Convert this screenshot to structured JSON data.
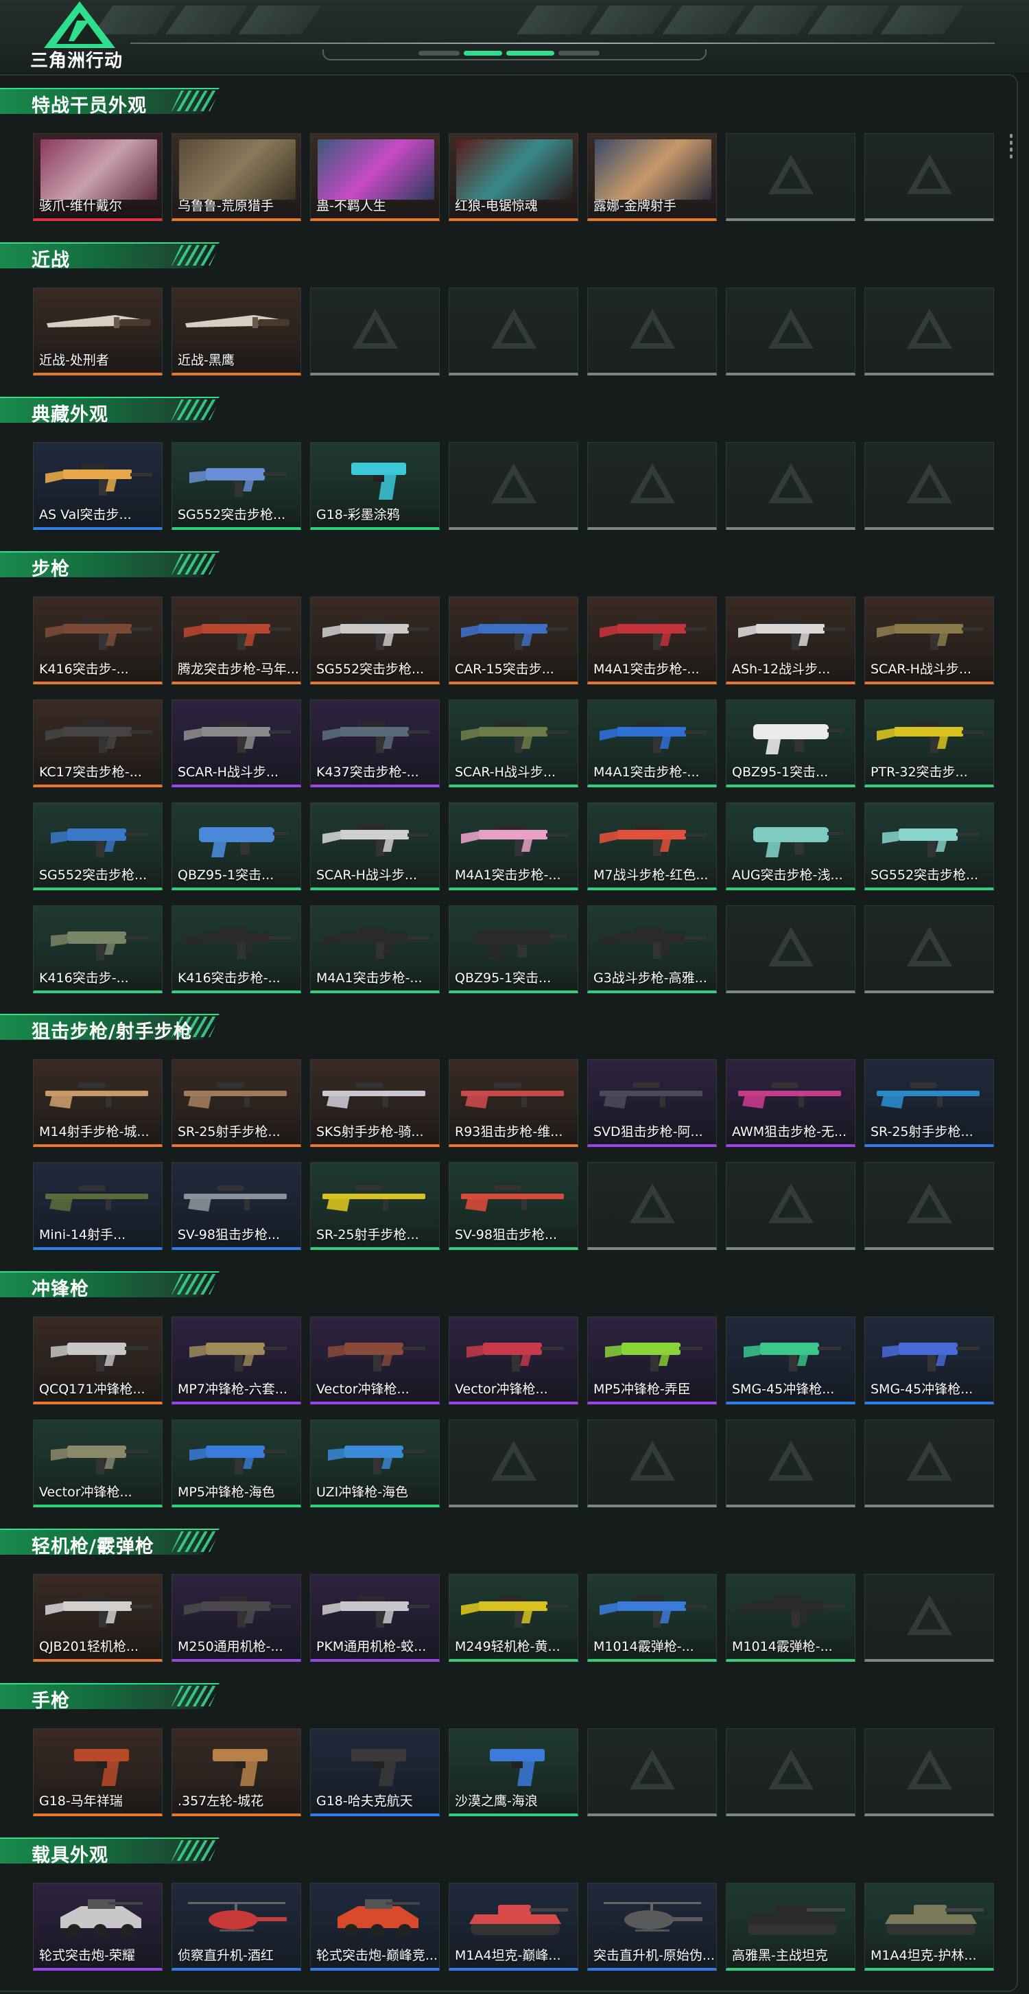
{
  "app": {
    "logo_text": "三角洲行动"
  },
  "sections": [
    {
      "title": "特战干员外观",
      "items": [
        {
          "name": "骇爪-维什戴尔",
          "rarity": "red",
          "kind": "operator"
        },
        {
          "name": "乌鲁鲁-荒原猎手",
          "rarity": "orange",
          "kind": "operator"
        },
        {
          "name": "蛊-不羁人生",
          "rarity": "orange",
          "kind": "operator"
        },
        {
          "name": "红狼-电锯惊魂",
          "rarity": "orange",
          "kind": "operator"
        },
        {
          "name": "露娜-金牌射手",
          "rarity": "orange",
          "kind": "operator"
        }
      ]
    },
    {
      "title": "近战",
      "items": [
        {
          "name": "近战-处刑者",
          "rarity": "orange",
          "kind": "knife"
        },
        {
          "name": "近战-黑鹰",
          "rarity": "orange",
          "kind": "knife"
        }
      ]
    },
    {
      "title": "典藏外观",
      "items": [
        {
          "name": "AS Val突击步...",
          "rarity": "blue",
          "kind": "rifle",
          "color": "#e6a84a"
        },
        {
          "name": "SG552突击步枪...",
          "rarity": "green",
          "kind": "smg",
          "color": "#6a8fd8"
        },
        {
          "name": "G18-彩墨涂鸦",
          "rarity": "green",
          "kind": "pistol",
          "color": "#3cc8d8"
        }
      ]
    },
    {
      "title": "步枪",
      "items": [
        {
          "name": "K416突击步-...",
          "rarity": "orange",
          "kind": "rifle",
          "color": "#7a4a36"
        },
        {
          "name": "腾龙突击步枪-马年...",
          "rarity": "orange",
          "kind": "rifle",
          "color": "#b8452e"
        },
        {
          "name": "SG552突击步枪...",
          "rarity": "orange",
          "kind": "rifle",
          "color": "#c9c9c9"
        },
        {
          "name": "CAR-15突击步...",
          "rarity": "orange",
          "kind": "rifle",
          "color": "#3d6fc4"
        },
        {
          "name": "M4A1突击步枪-...",
          "rarity": "orange",
          "kind": "rifle",
          "color": "#c4323c"
        },
        {
          "name": "ASh-12战斗步...",
          "rarity": "orange",
          "kind": "rifle",
          "color": "#d8d8d8"
        },
        {
          "name": "SCAR-H战斗步...",
          "rarity": "orange",
          "kind": "rifle",
          "color": "#8a7a4a"
        },
        {
          "name": "KC17突击步枪-...",
          "rarity": "orange",
          "kind": "rifle",
          "color": "#444"
        },
        {
          "name": "SCAR-H战斗步...",
          "rarity": "purple",
          "kind": "rifle",
          "color": "#8a8a8a"
        },
        {
          "name": "K437突击步枪-...",
          "rarity": "purple",
          "kind": "rifle",
          "color": "#5a6a7a"
        },
        {
          "name": "SCAR-H战斗步...",
          "rarity": "green",
          "kind": "rifle",
          "color": "#6d7a4a"
        },
        {
          "name": "M4A1突击步枪-...",
          "rarity": "green",
          "kind": "rifle",
          "color": "#2f6fd8"
        },
        {
          "name": "QBZ95-1突击...",
          "rarity": "green",
          "kind": "bullpup",
          "color": "#eaeaea"
        },
        {
          "name": "PTR-32突击步...",
          "rarity": "green",
          "kind": "rifle",
          "color": "#d8c21e"
        },
        {
          "name": "SG552突击步枪...",
          "rarity": "green",
          "kind": "smg",
          "color": "#3a78c8"
        },
        {
          "name": "QBZ95-1突击...",
          "rarity": "green",
          "kind": "bullpup",
          "color": "#4a88d8"
        },
        {
          "name": "SCAR-H战斗步...",
          "rarity": "green",
          "kind": "rifle",
          "color": "#d0d0d0"
        },
        {
          "name": "M4A1突击步枪-...",
          "rarity": "green",
          "kind": "rifle",
          "color": "#e8a0c4"
        },
        {
          "name": "M7战斗步枪-红色...",
          "rarity": "green",
          "kind": "rifle",
          "color": "#e0503a"
        },
        {
          "name": "AUG突击步枪-浅...",
          "rarity": "green",
          "kind": "bullpup",
          "color": "#7ecbc4"
        },
        {
          "name": "SG552突击步枪...",
          "rarity": "green",
          "kind": "smg",
          "color": "#8ad4cf"
        },
        {
          "name": "K416突击步-...",
          "rarity": "green",
          "kind": "smg",
          "color": "#7a8466"
        },
        {
          "name": "K416突击步枪-...",
          "rarity": "green",
          "kind": "rifle",
          "color": "#2a2a2a"
        },
        {
          "name": "M4A1突击步枪-...",
          "rarity": "green",
          "kind": "rifle",
          "color": "#2a2a2a"
        },
        {
          "name": "QBZ95-1突击...",
          "rarity": "green",
          "kind": "bullpup",
          "color": "#2a2a2a"
        },
        {
          "name": "G3战斗步枪-高雅...",
          "rarity": "green",
          "kind": "rifle",
          "color": "#2a2a2a"
        }
      ]
    },
    {
      "title": "狙击步枪/射手步枪",
      "items": [
        {
          "name": "M14射手步枪-城...",
          "rarity": "orange",
          "kind": "sniper",
          "color": "#c89a6a"
        },
        {
          "name": "SR-25射手步枪...",
          "rarity": "orange",
          "kind": "sniper",
          "color": "#a07a5a"
        },
        {
          "name": "SKS射手步枪-骑...",
          "rarity": "orange",
          "kind": "sniper",
          "color": "#c8c8d0"
        },
        {
          "name": "R93狙击步枪-维...",
          "rarity": "orange",
          "kind": "sniper",
          "color": "#c84a4a"
        },
        {
          "name": "SVD狙击步枪-阿...",
          "rarity": "purple",
          "kind": "sniper",
          "color": "#4a4a5a"
        },
        {
          "name": "AWM狙击步枪-无...",
          "rarity": "purple",
          "kind": "sniper",
          "color": "#c83a8a"
        },
        {
          "name": "SR-25射手步枪...",
          "rarity": "blue",
          "kind": "sniper",
          "color": "#2a8ac8"
        },
        {
          "name": "Mini-14射手...",
          "rarity": "blue",
          "kind": "sniper",
          "color": "#5a6a3a"
        },
        {
          "name": "SV-98狙击步枪...",
          "rarity": "blue",
          "kind": "sniper",
          "color": "#8a9098"
        },
        {
          "name": "SR-25射手步枪...",
          "rarity": "green",
          "kind": "sniper",
          "color": "#d8c21e"
        },
        {
          "name": "SV-98狙击步枪...",
          "rarity": "green",
          "kind": "sniper",
          "color": "#d84a3a"
        }
      ]
    },
    {
      "title": "冲锋枪",
      "items": [
        {
          "name": "QCQ171冲锋枪...",
          "rarity": "orange",
          "kind": "smg",
          "color": "#c8c8c8"
        },
        {
          "name": "MP7冲锋枪-六套...",
          "rarity": "purple",
          "kind": "smg",
          "color": "#a08a5a"
        },
        {
          "name": "Vector冲锋枪...",
          "rarity": "purple",
          "kind": "smg",
          "color": "#8a4a3a"
        },
        {
          "name": "Vector冲锋枪...",
          "rarity": "purple",
          "kind": "smg",
          "color": "#c83a4a"
        },
        {
          "name": "MP5冲锋枪-弄臣",
          "rarity": "purple",
          "kind": "smg",
          "color": "#8ad43a"
        },
        {
          "name": "SMG-45冲锋枪...",
          "rarity": "blue",
          "kind": "smg",
          "color": "#3ac88a"
        },
        {
          "name": "SMG-45冲锋枪...",
          "rarity": "blue",
          "kind": "smg",
          "color": "#4a6ad8"
        },
        {
          "name": "Vector冲锋枪...",
          "rarity": "green",
          "kind": "smg",
          "color": "#8a8a6a"
        },
        {
          "name": "MP5冲锋枪-海色",
          "rarity": "green",
          "kind": "smg",
          "color": "#3a7ad8"
        },
        {
          "name": "UZI冲锋枪-海色",
          "rarity": "green",
          "kind": "smg",
          "color": "#3a8ad8"
        }
      ]
    },
    {
      "title": "轻机枪/霰弹枪",
      "items": [
        {
          "name": "QJB201轻机枪...",
          "rarity": "orange",
          "kind": "rifle",
          "color": "#d0d0d0"
        },
        {
          "name": "M250通用机枪-...",
          "rarity": "purple",
          "kind": "rifle",
          "color": "#4a4a4a"
        },
        {
          "name": "PKM通用机枪-蛟...",
          "rarity": "purple",
          "kind": "rifle",
          "color": "#c8c8c8"
        },
        {
          "name": "M249轻机枪-黄...",
          "rarity": "green",
          "kind": "rifle",
          "color": "#d8c21e"
        },
        {
          "name": "M1014霰弹枪-...",
          "rarity": "green",
          "kind": "rifle",
          "color": "#3a7ad8"
        },
        {
          "name": "M1014霰弹枪-...",
          "rarity": "green",
          "kind": "rifle",
          "color": "#2a2a2a"
        }
      ]
    },
    {
      "title": "手枪",
      "items": [
        {
          "name": "G18-马年祥瑞",
          "rarity": "orange",
          "kind": "pistol",
          "color": "#b84a2a"
        },
        {
          "name": ".357左轮-城花",
          "rarity": "orange",
          "kind": "pistol",
          "color": "#b8804a"
        },
        {
          "name": "G18-哈夫克航天",
          "rarity": "blue",
          "kind": "pistol",
          "color": "#3a3a3a"
        },
        {
          "name": "沙漠之鹰-海浪",
          "rarity": "green",
          "kind": "pistol",
          "color": "#3a7ad8"
        }
      ]
    },
    {
      "title": "载具外观",
      "items": [
        {
          "name": "轮式突击炮-荣耀",
          "rarity": "purple",
          "kind": "vehicle",
          "color": "#c8c8c8"
        },
        {
          "name": "侦察直升机-酒红",
          "rarity": "blue",
          "kind": "heli",
          "color": "#c83a3a"
        },
        {
          "name": "轮式突击炮-巅峰竞...",
          "rarity": "blue",
          "kind": "vehicle",
          "color": "#d84a2a"
        },
        {
          "name": "M1A4坦克-巅峰...",
          "rarity": "blue",
          "kind": "tank",
          "color": "#d84a4a"
        },
        {
          "name": "突击直升机-原始伪...",
          "rarity": "blue",
          "kind": "heli",
          "color": "#5a5a5a"
        },
        {
          "name": "高雅黑-主战坦克",
          "rarity": "green",
          "kind": "tank",
          "color": "#2a2a2a"
        },
        {
          "name": "M1A4坦克-护林...",
          "rarity": "green",
          "kind": "tank",
          "color": "#7a7a5a"
        }
      ]
    }
  ]
}
